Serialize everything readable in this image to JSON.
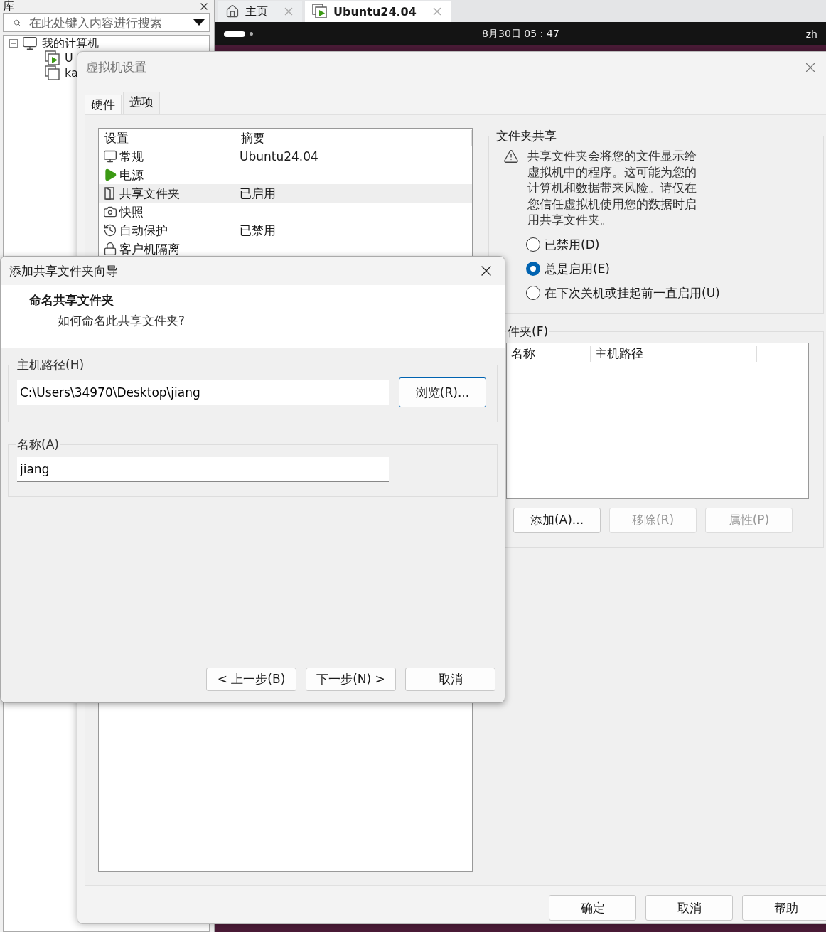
{
  "library": {
    "title": "库",
    "search": {
      "placeholder": "在此处键入内容进行搜索"
    },
    "tree": [
      {
        "label": "我的计算机",
        "expanded": true,
        "children": [
          {
            "label": "U",
            "running": true
          },
          {
            "label": "ka",
            "running": false
          }
        ]
      }
    ]
  },
  "tabs": [
    {
      "label": "主页",
      "kind": "home",
      "selected": false
    },
    {
      "label": "Ubuntu24.04",
      "kind": "vm",
      "selected": true
    }
  ],
  "guest_top_bar": {
    "datetime": "8月30日 05：47",
    "language": "zh"
  },
  "settings_dialog": {
    "title": "虚拟机设置",
    "tabs": [
      {
        "label": "硬件",
        "selected": false
      },
      {
        "label": "选项",
        "selected": true
      }
    ],
    "list": {
      "columns": [
        "设置",
        "摘要"
      ],
      "rows": [
        {
          "kind": "general",
          "name": "常规",
          "summary": "Ubuntu24.04",
          "selected": false
        },
        {
          "kind": "power",
          "name": "电源",
          "selected": false
        },
        {
          "kind": "shared",
          "name": "共享文件夹",
          "summary": "已启用",
          "selected": true
        },
        {
          "kind": "snapshot",
          "name": "快照",
          "selected": false
        },
        {
          "kind": "autoprotect",
          "name": "自动保护",
          "summary": "已禁用",
          "selected": false
        },
        {
          "kind": "isolation",
          "name": "客户机隔离",
          "selected": false
        }
      ]
    },
    "folder_sharing": {
      "legend": "文件夹共享",
      "warning": "共享文件夹会将您的文件显示给虚拟机中的程序。这可能为您的计算机和数据带来风险。请仅在您信任虚拟机使用您的数据时启用共享文件夹。",
      "options": [
        {
          "label": "已禁用(D)",
          "selected": false
        },
        {
          "label": "总是启用(E)",
          "selected": true
        },
        {
          "label": "在下次关机或挂起前一直启用(U)",
          "selected": false
        }
      ]
    },
    "folders": {
      "legend": "件夹(F)",
      "columns": [
        "名称",
        "主机路径"
      ],
      "buttons": [
        {
          "label": "添加(A)...",
          "disabled": false
        },
        {
          "label": "移除(R)",
          "disabled": true
        },
        {
          "label": "属性(P)",
          "disabled": true
        }
      ]
    },
    "buttons": [
      "确定",
      "取消",
      "帮助"
    ]
  },
  "wizard": {
    "title": "添加共享文件夹向导",
    "heading": "命名共享文件夹",
    "subheading": "如何命名此共享文件夹?",
    "host_path": {
      "label": "主机路径(H)",
      "value": "C:\\Users\\34970\\Desktop\\jiang",
      "browse": "浏览(R)..."
    },
    "name": {
      "label": "名称(A)",
      "value": "jiang"
    },
    "buttons": [
      "< 上一步(B)",
      "下一步(N) >",
      "取消"
    ]
  }
}
